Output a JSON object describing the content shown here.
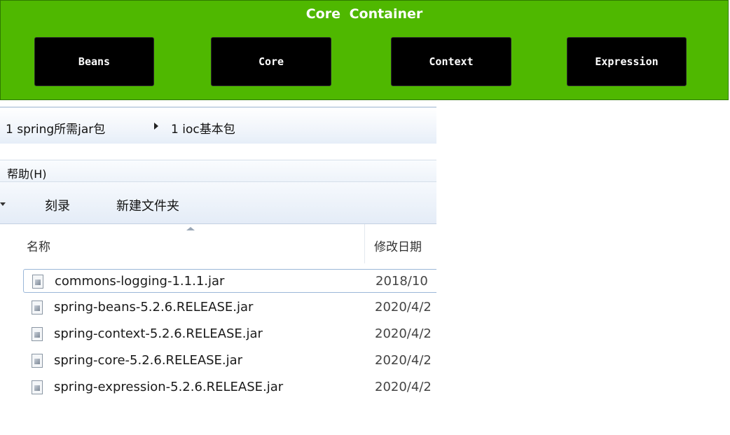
{
  "core_container": {
    "title": "Core  Container",
    "modules": [
      "Beans",
      "Core",
      "Context",
      "Expression"
    ]
  },
  "explorer": {
    "breadcrumb": [
      "1 spring所需jar包",
      "1 ioc基本包"
    ],
    "menu": {
      "help": "帮助(H)"
    },
    "toolbar": {
      "burn": "刻录",
      "new_folder": "新建文件夹"
    },
    "columns": {
      "name": "名称",
      "date_modified": "修改日期"
    },
    "files": [
      {
        "name": "commons-logging-1.1.1.jar",
        "date": "2018/10",
        "selected": true
      },
      {
        "name": "spring-beans-5.2.6.RELEASE.jar",
        "date": "2020/4/2"
      },
      {
        "name": "spring-context-5.2.6.RELEASE.jar",
        "date": "2020/4/2"
      },
      {
        "name": "spring-core-5.2.6.RELEASE.jar",
        "date": "2020/4/2"
      },
      {
        "name": "spring-expression-5.2.6.RELEASE.jar",
        "date": "2020/4/2"
      }
    ]
  },
  "colors": {
    "core_bg": "#4fb800",
    "module_bg": "#000000"
  }
}
